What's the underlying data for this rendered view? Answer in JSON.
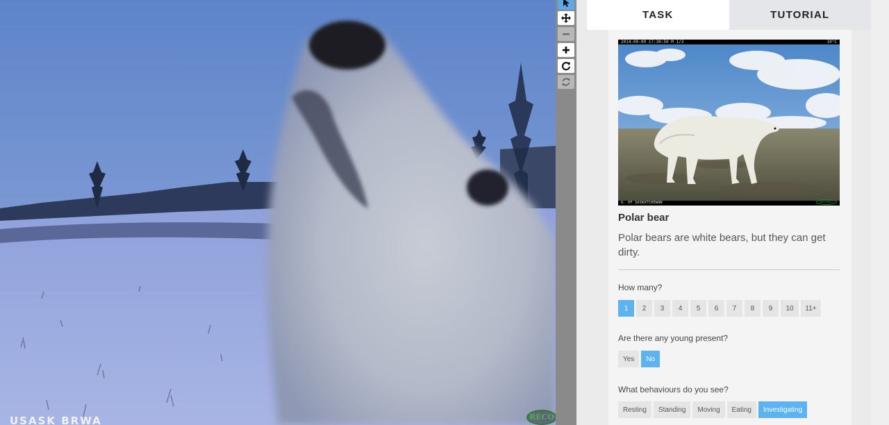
{
  "viewer": {
    "overlay_text": "USASK BRWA",
    "logo_text": "RECO"
  },
  "toolbar": {
    "tools": [
      {
        "name": "pointer-icon",
        "state": "active"
      },
      {
        "name": "move-icon",
        "state": "normal"
      },
      {
        "name": "zoom-out-icon",
        "state": "disabled"
      },
      {
        "name": "zoom-in-icon",
        "state": "normal"
      },
      {
        "name": "rotate-icon",
        "state": "normal"
      },
      {
        "name": "reset-icon",
        "state": "disabled"
      }
    ]
  },
  "tabs": [
    {
      "label": "TASK",
      "active": true
    },
    {
      "label": "TUTORIAL",
      "active": false
    }
  ],
  "species": {
    "photo_stamp_left": "2014-09-09 17:39:50   M 1/3",
    "photo_stamp_right": "10°C",
    "photo_footer": "U. OF SASKATCHEWAN",
    "photo_logo": "RECONYX",
    "name": "Polar bear",
    "description": "Polar bears are white bears, but they can get dirty."
  },
  "questions": {
    "how_many": {
      "label": "How many?",
      "options": [
        "1",
        "2",
        "3",
        "4",
        "5",
        "6",
        "7",
        "8",
        "9",
        "10",
        "11+"
      ],
      "selected": "1"
    },
    "young": {
      "label": "Are there any young present?",
      "options": [
        "Yes",
        "No"
      ],
      "selected": "No"
    },
    "behaviours": {
      "label": "What behaviours do you see?",
      "options": [
        "Resting",
        "Standing",
        "Moving",
        "Eating",
        "Investigating"
      ],
      "selected": [
        "Investigating"
      ]
    }
  },
  "colors": {
    "selected_answer": "#5cb3f0",
    "active_tool": "#5fa8e8",
    "toolbar": "#8a8a8a"
  }
}
